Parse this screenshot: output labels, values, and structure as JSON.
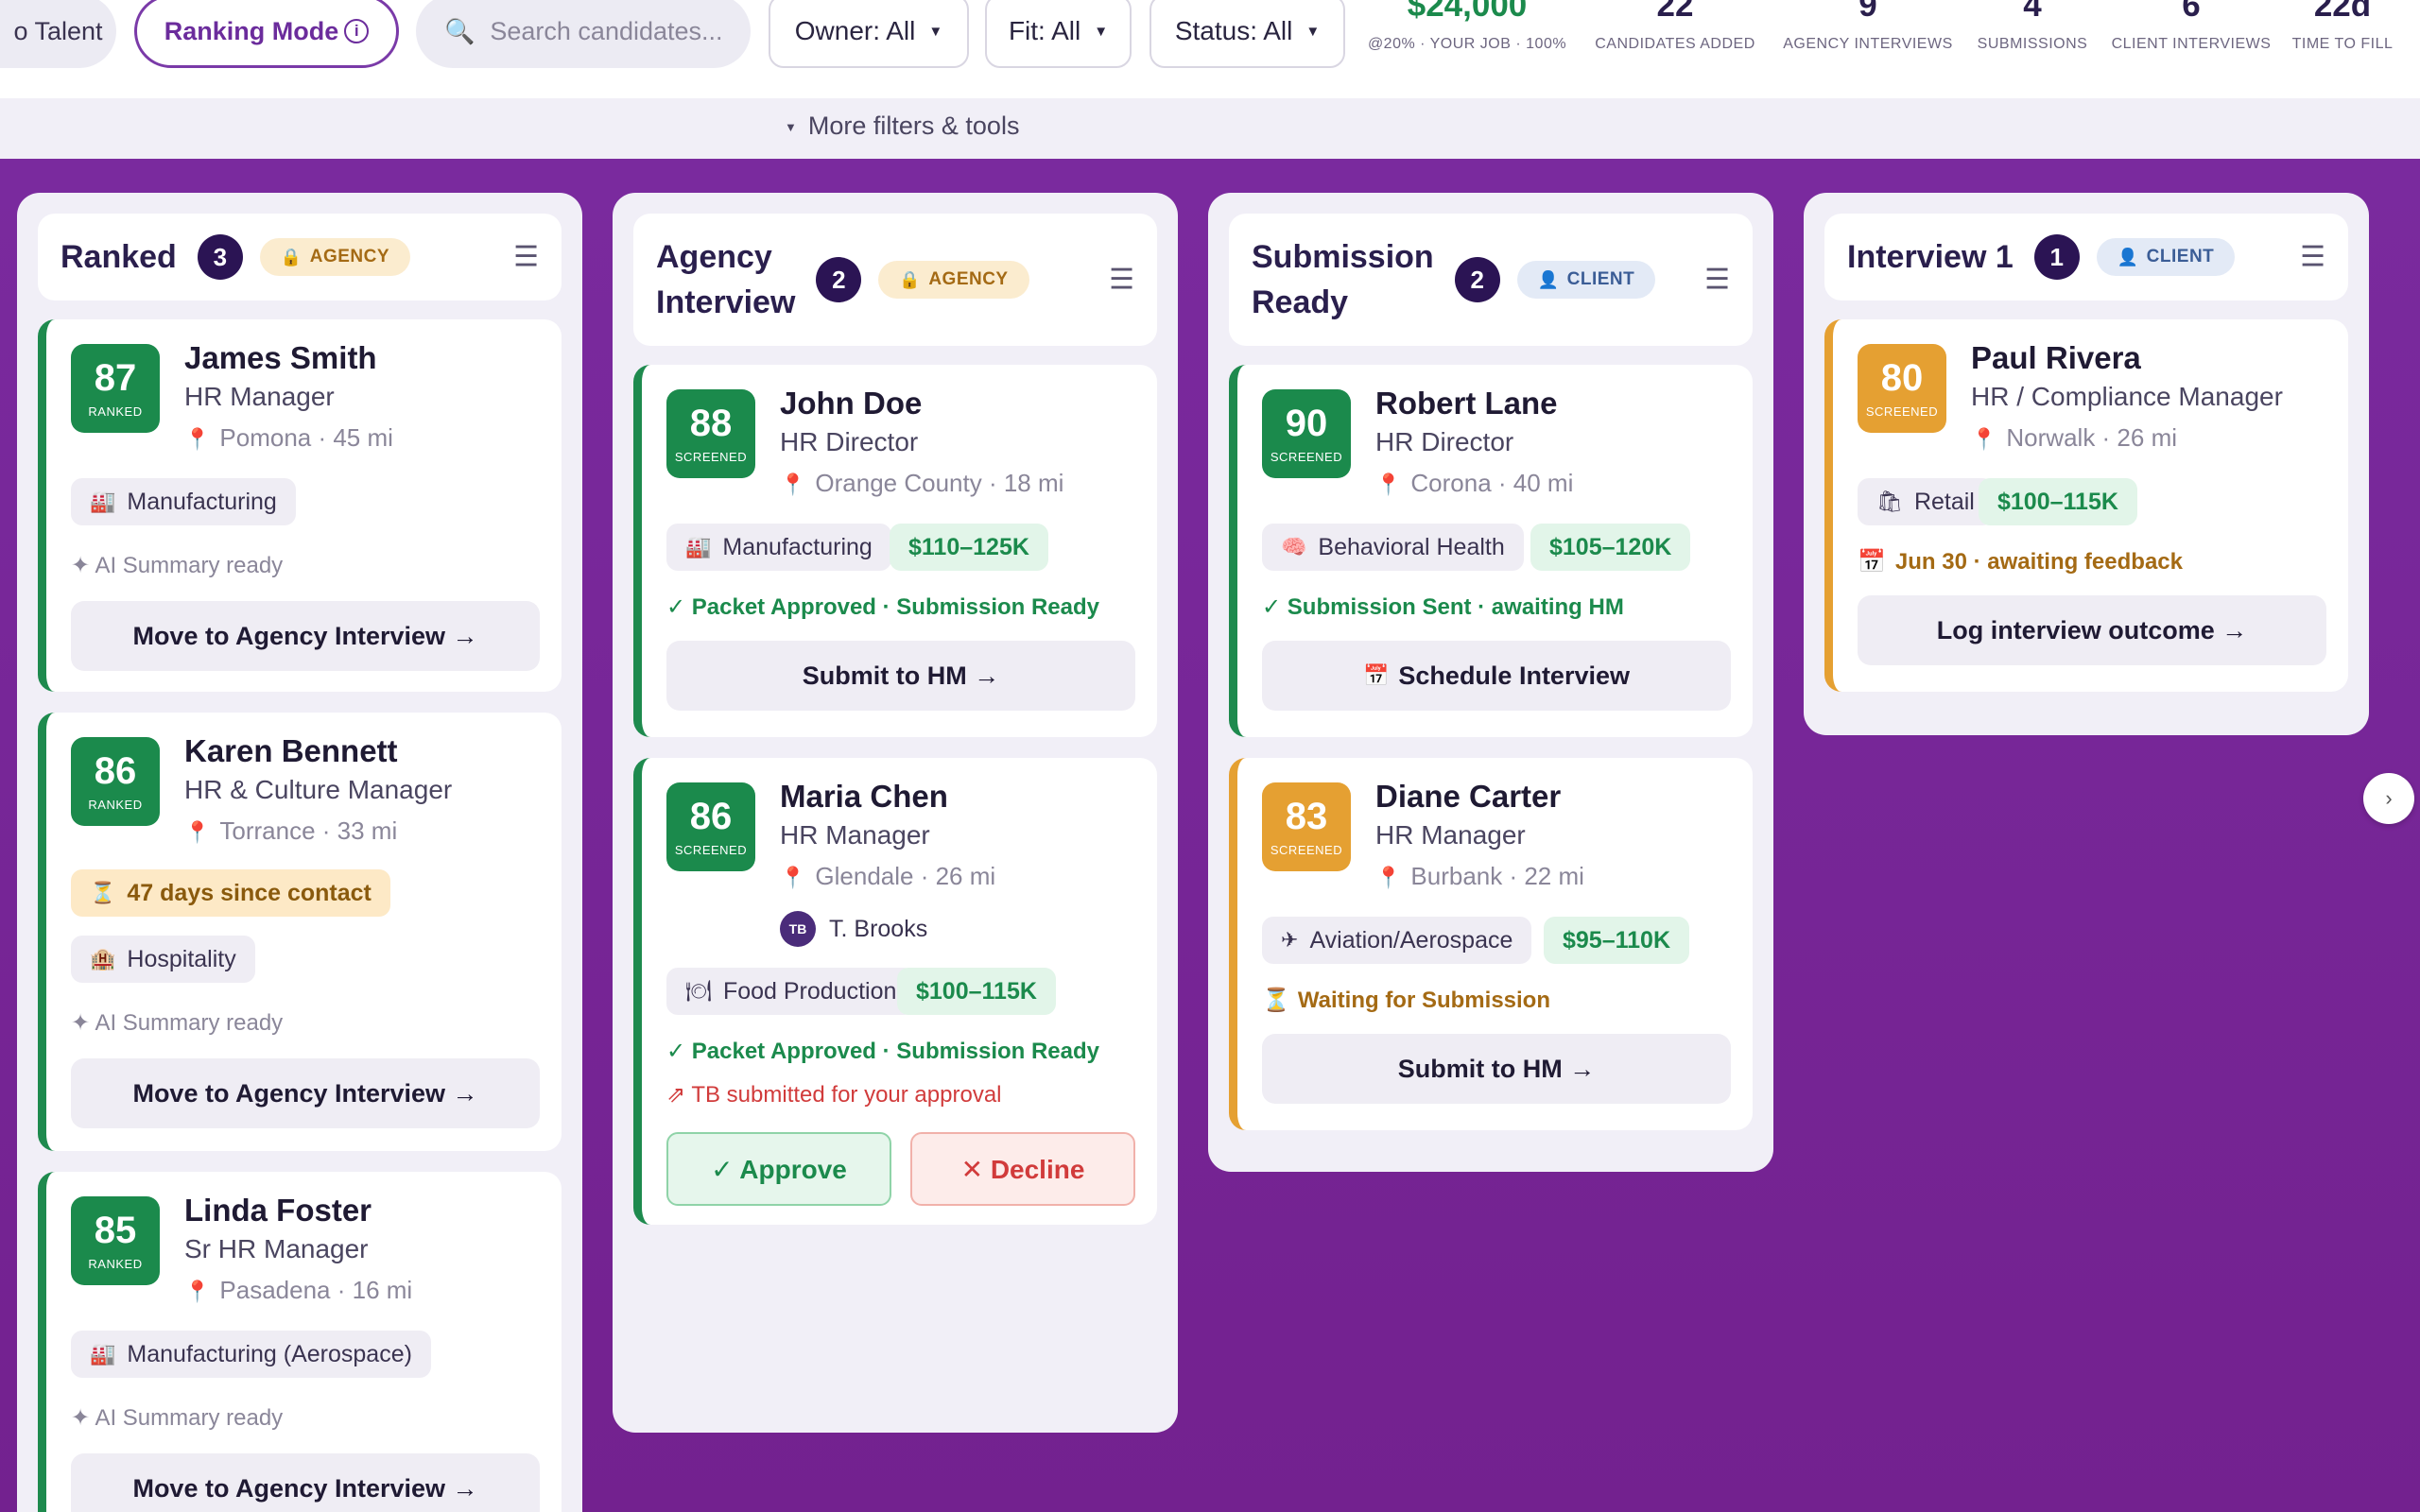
{
  "toolbar": {
    "talent_tab": "o Talent",
    "ranking_mode": "Ranking Mode",
    "info_icon": "i",
    "search_placeholder": "Search candidates...",
    "owner_filter": "Owner: All",
    "fit_filter": "Fit: All",
    "status_filter": "Status: All",
    "more_filters": "More filters & tools"
  },
  "stats": [
    {
      "value": "$24,000",
      "label": "@20% · YOUR JOB · 100%"
    },
    {
      "value": "22",
      "label": "CANDIDATES ADDED"
    },
    {
      "value": "9",
      "label": "AGENCY INTERVIEWS"
    },
    {
      "value": "4",
      "label": "SUBMISSIONS"
    },
    {
      "value": "6",
      "label": "CLIENT INTERVIEWS"
    },
    {
      "value": "22d",
      "label": "TIME TO FILL"
    }
  ],
  "columns": [
    {
      "title": "Ranked",
      "count": "3",
      "tag": "AGENCY",
      "cards": [
        {
          "score": "87",
          "score_status": "RANKED",
          "name": "James Smith",
          "role": "HR Manager",
          "location": "Pomona · 45 mi",
          "industry": "Manufacturing",
          "ai": "✦ AI Summary ready",
          "action": "Move to Agency Interview →"
        },
        {
          "score": "86",
          "score_status": "RANKED",
          "name": "Karen Bennett",
          "role": "HR & Culture Manager",
          "location": "Torrance · 33 mi",
          "warning": "47 days since contact",
          "industry": "Hospitality",
          "ai": "✦ AI Summary ready",
          "action": "Move to Agency Interview →"
        },
        {
          "score": "85",
          "score_status": "RANKED",
          "name": "Linda Foster",
          "role": "Sr HR Manager",
          "location": "Pasadena · 16 mi",
          "industry": "Manufacturing (Aerospace)",
          "ai": "✦ AI Summary ready",
          "action": "Move to Agency Interview →"
        }
      ]
    },
    {
      "title_line1": "Agency",
      "title_line2": "Interview",
      "count": "2",
      "tag": "AGENCY",
      "cards": [
        {
          "score": "88",
          "score_status": "SCREENED",
          "name": "John Doe",
          "role": "HR Director",
          "location": "Orange County · 18 mi",
          "industry": "Manufacturing",
          "salary": "$110–125K",
          "status": "✓ Packet Approved · Submission Ready",
          "action": "Submit to HM →"
        },
        {
          "score": "86",
          "score_status": "SCREENED",
          "name": "Maria Chen",
          "role": "HR Manager",
          "location": "Glendale · 26 mi",
          "owner_initials": "TB",
          "owner_name": "T. Brooks",
          "industry": "Food Production",
          "salary": "$100–115K",
          "status": "✓ Packet Approved · Submission Ready",
          "note": "⇗ TB submitted for your approval",
          "approve": "✓ Approve",
          "decline": "✕ Decline"
        }
      ]
    },
    {
      "title_line1": "Submission",
      "title_line2": "Ready",
      "count": "2",
      "tag": "CLIENT",
      "cards": [
        {
          "score": "90",
          "score_status": "SCREENED",
          "name": "Robert Lane",
          "role": "HR Director",
          "location": "Corona · 40 mi",
          "industry": "Behavioral Health",
          "salary": "$105–120K",
          "status": "✓ Submission Sent · awaiting HM",
          "action": "Schedule Interview"
        },
        {
          "score": "83",
          "score_status": "SCREENED",
          "name": "Diane Carter",
          "role": "HR Manager",
          "location": "Burbank · 22 mi",
          "industry": "Aviation/Aerospace",
          "salary": "$95–110K",
          "status": "Waiting for Submission",
          "action": "Submit to HM →"
        }
      ]
    },
    {
      "title": "Interview 1",
      "count": "1",
      "tag": "CLIENT",
      "cards": [
        {
          "score": "80",
          "score_status": "SCREENED",
          "name": "Paul Rivera",
          "role": "HR / Compliance Manager",
          "location": "Norwalk · 26 mi",
          "industry": "Retail",
          "salary": "$100–115K",
          "status": "Jun 30 · awaiting feedback",
          "action": "Log interview outcome →"
        }
      ]
    }
  ],
  "colors": {
    "brand": "#7a2a9e",
    "score_green": "#1b8a4c",
    "score_amber": "#e5a032"
  }
}
